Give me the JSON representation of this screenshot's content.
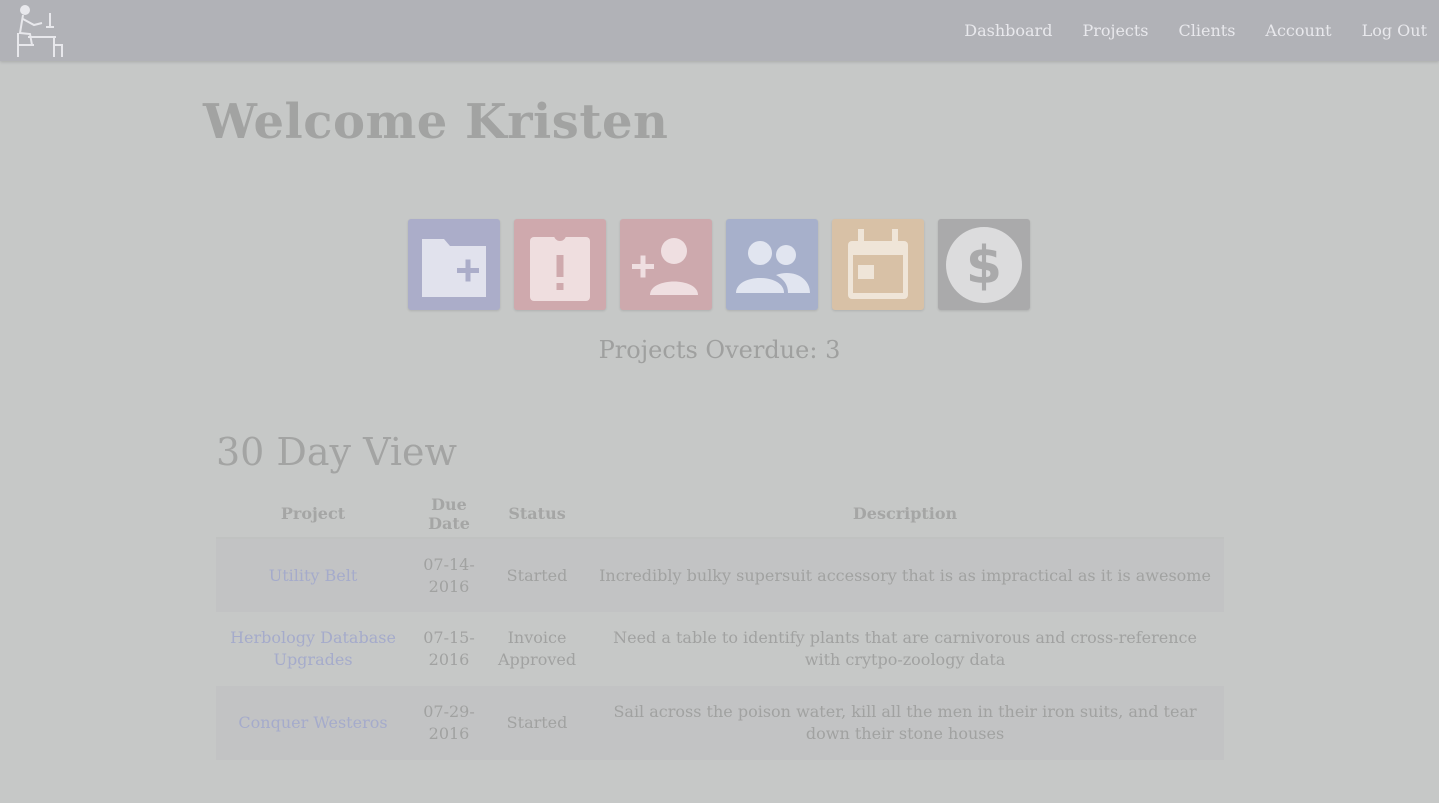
{
  "nav": {
    "links": [
      "Dashboard",
      "Projects",
      "Clients",
      "Account",
      "Log Out"
    ]
  },
  "welcome": "Welcome Kristen",
  "tiles": [
    {
      "icon": "folder-add-icon",
      "color": "#abadc9"
    },
    {
      "icon": "alert-clipboard-icon",
      "color": "#cfa9ad"
    },
    {
      "icon": "add-person-icon",
      "color": "#cda9ad"
    },
    {
      "icon": "group-icon",
      "color": "#a7b0cb"
    },
    {
      "icon": "calendar-icon",
      "color": "#d8c1a6"
    },
    {
      "icon": "dollar-icon",
      "color": "#aaaaab"
    }
  ],
  "overdue": {
    "label": "Projects Overdue:",
    "value": "3"
  },
  "thirty_day": {
    "title": "30 Day View",
    "columns": [
      "Project",
      "Due Date",
      "Status",
      "Description"
    ],
    "rows": [
      {
        "project": "Utility Belt",
        "due": "07-14-2016",
        "status": "Started",
        "description": "Incredibly bulky supersuit accessory that is as impractical as it is awesome"
      },
      {
        "project": "Herbology Database Upgrades",
        "due": "07-15-2016",
        "status": "Invoice Approved",
        "description": "Need a table to identify plants that are carnivorous and cross-reference with crytpo-zoology data"
      },
      {
        "project": "Conquer Westeros",
        "due": "07-29-2016",
        "status": "Started",
        "description": "Sail across the poison water, kill all the men in their iron suits, and tear down their stone houses"
      }
    ]
  }
}
